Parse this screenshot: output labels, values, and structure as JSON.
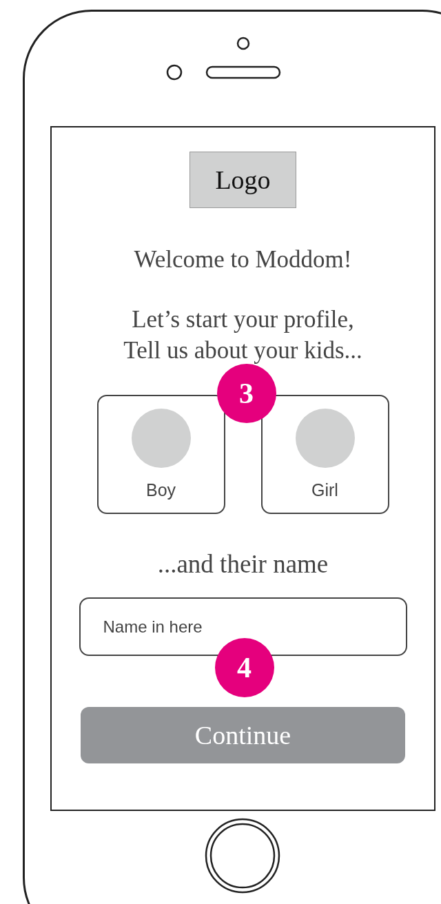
{
  "logo": {
    "label": "Logo"
  },
  "welcome": "Welcome to Moddom!",
  "prompt_lines": [
    "Let’s start your profile,",
    "Tell us about your kids..."
  ],
  "options": [
    {
      "label": "Boy",
      "selected": false
    },
    {
      "label": "Girl",
      "selected": false
    }
  ],
  "name_heading": "...and their name",
  "name_field": {
    "placeholder": "Name in here"
  },
  "continue_button": {
    "label": "Continue"
  },
  "annotations": [
    {
      "label": "3"
    },
    {
      "label": "4"
    }
  ]
}
